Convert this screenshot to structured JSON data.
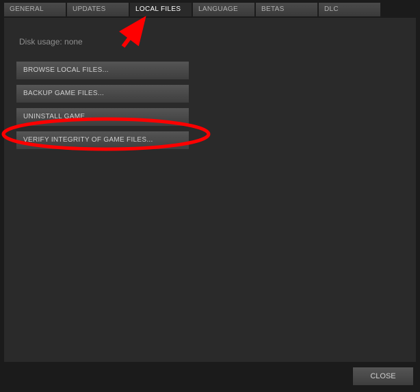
{
  "tabs": [
    {
      "label": "GENERAL",
      "active": false
    },
    {
      "label": "UPDATES",
      "active": false
    },
    {
      "label": "LOCAL FILES",
      "active": true
    },
    {
      "label": "LANGUAGE",
      "active": false
    },
    {
      "label": "BETAS",
      "active": false
    },
    {
      "label": "DLC",
      "active": false
    }
  ],
  "disk_usage_label": "Disk usage: none",
  "buttons": {
    "browse": "BROWSE LOCAL FILES...",
    "backup": "BACKUP GAME FILES...",
    "uninstall": "UNINSTALL GAME...",
    "verify": "VERIFY INTEGRITY OF GAME FILES..."
  },
  "close_label": "CLOSE",
  "annotation": {
    "arrow_color": "#ff0000",
    "circle_color": "#ff0000"
  }
}
